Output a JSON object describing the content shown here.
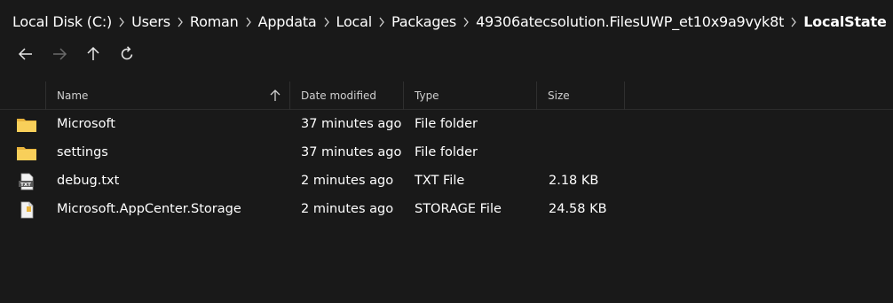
{
  "breadcrumb": {
    "items": [
      "Local Disk (C:)",
      "Users",
      "Roman",
      "Appdata",
      "Local",
      "Packages",
      "49306atecsolution.FilesUWP_et10x9a9vyk8t",
      "LocalState"
    ]
  },
  "columns": {
    "name": "Name",
    "date": "Date modified",
    "type": "Type",
    "size": "Size"
  },
  "files": [
    {
      "name": "Microsoft",
      "date": "37 minutes ago",
      "type": "File folder",
      "size": "",
      "icon": "folder-icon"
    },
    {
      "name": "settings",
      "date": "37 minutes ago",
      "type": "File folder",
      "size": "",
      "icon": "folder-icon"
    },
    {
      "name": "debug.txt",
      "date": "2 minutes ago",
      "type": "TXT File",
      "size": "2.18 KB",
      "icon": "txt-file-icon"
    },
    {
      "name": "Microsoft.AppCenter.Storage",
      "date": "2 minutes ago",
      "type": "STORAGE File",
      "size": "24.58 KB",
      "icon": "storage-file-icon"
    }
  ],
  "colors": {
    "background": "#191919",
    "folder": "#f8cf5a"
  }
}
